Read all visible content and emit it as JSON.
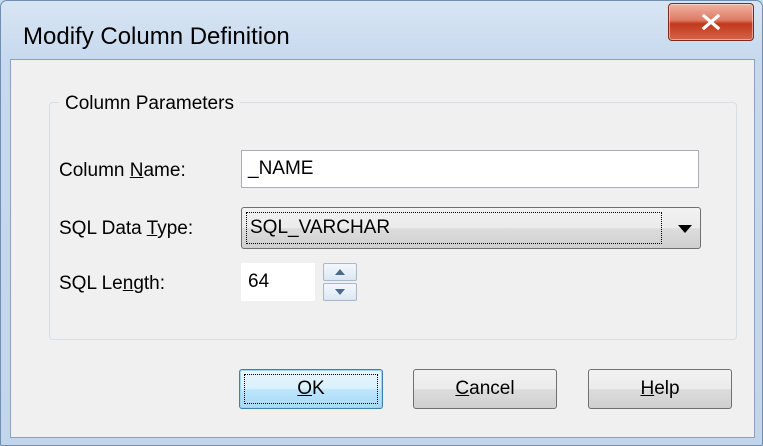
{
  "window": {
    "title": "Modify Column Definition",
    "close_icon": "close-x-icon"
  },
  "group": {
    "label": "Column Parameters"
  },
  "fields": {
    "column_name": {
      "label_pre": "Column ",
      "label_accel": "N",
      "label_post": "ame:",
      "value": "_NAME"
    },
    "sql_data_type": {
      "label_pre": "SQL Data ",
      "label_accel": "T",
      "label_post": "ype:",
      "value": "SQL_VARCHAR"
    },
    "sql_length": {
      "label_pre": "SQL Le",
      "label_accel": "n",
      "label_post": "gth:",
      "value": "64"
    }
  },
  "buttons": {
    "ok": {
      "accel": "O",
      "rest": "K"
    },
    "cancel": {
      "accel": "C",
      "rest": "ancel"
    },
    "help": {
      "accel": "H",
      "rest": "elp"
    }
  },
  "colors": {
    "close_button": "#c2391b",
    "default_button_border": "#3c7fb1",
    "dialog_face": "#f0f0f0"
  }
}
